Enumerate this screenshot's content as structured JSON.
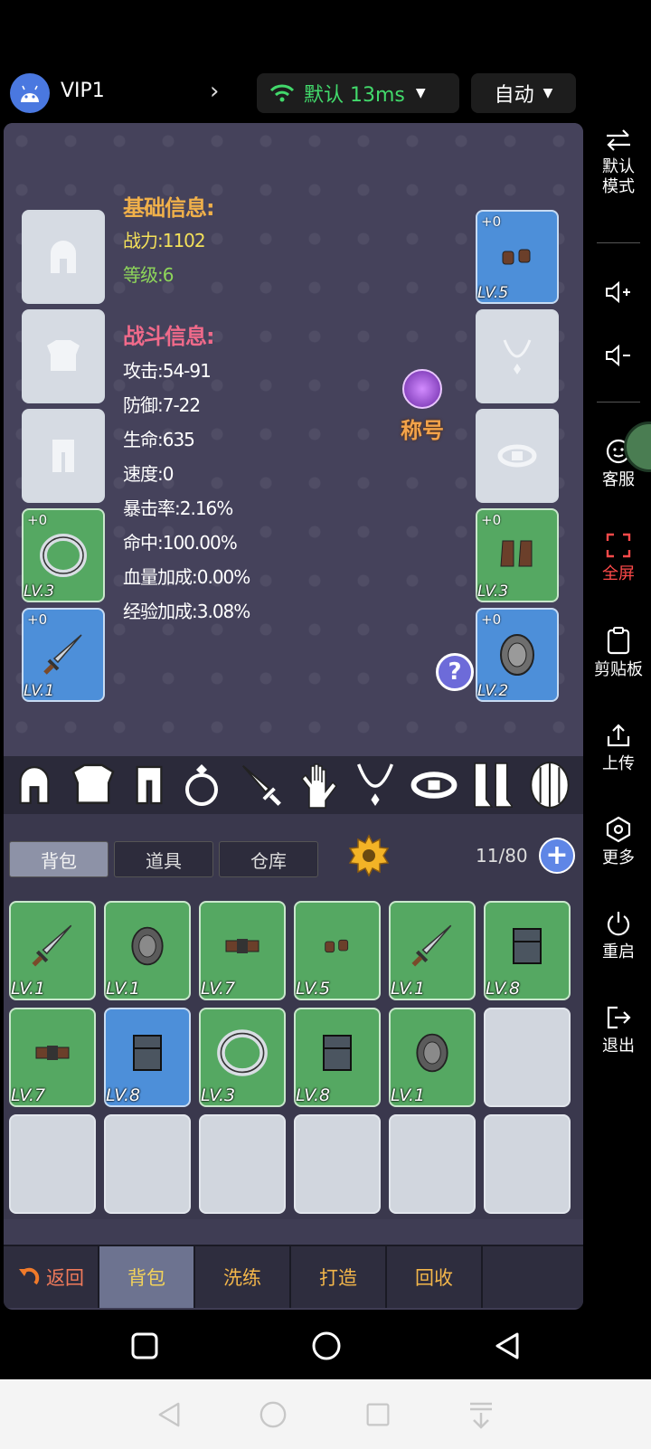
{
  "topbar": {
    "vip_label": "VIP1",
    "network_label": "默认 13ms",
    "mode_label": "自动"
  },
  "sidebar": {
    "items": [
      {
        "label": "默认\n模式",
        "label_line1": "默认",
        "label_line2": "模式",
        "icon": "swap-icon"
      },
      {
        "label": "",
        "icon": "volume-up-icon"
      },
      {
        "label": "",
        "icon": "volume-down-icon"
      },
      {
        "label": "客服",
        "icon": "chat-icon"
      },
      {
        "label": "全屏",
        "icon": "fullscreen-icon",
        "color": "#ff4a4a"
      },
      {
        "label": "剪贴板",
        "icon": "clipboard-icon"
      },
      {
        "label": "上传",
        "icon": "upload-icon"
      },
      {
        "label": "更多",
        "icon": "more-icon"
      },
      {
        "label": "重启",
        "icon": "power-icon"
      },
      {
        "label": "退出",
        "icon": "exit-icon"
      }
    ]
  },
  "character": {
    "base_title": "基础信息:",
    "power": "战力:1102",
    "level": "等级:6",
    "fight_title": "战斗信息:",
    "attack": "攻击:54-91",
    "defense": "防御:7-22",
    "hp": "生命:635",
    "speed": "速度:0",
    "crit": "暴击率:2.16%",
    "hit": "命中:100.00%",
    "hp_bonus": "血量加成:0.00%",
    "exp_bonus": "经验加成:3.08%",
    "title_badge": "称号",
    "help": "?"
  },
  "equip_left": [
    {
      "state": "empty",
      "icon": "helmet-icon"
    },
    {
      "state": "empty",
      "icon": "armor-icon"
    },
    {
      "state": "empty",
      "icon": "pants-icon"
    },
    {
      "state": "green",
      "icon": "ring-icon",
      "plus": "+0",
      "lv": "LV.3"
    },
    {
      "state": "blue",
      "icon": "sword-icon",
      "plus": "+0",
      "lv": "LV.1"
    }
  ],
  "equip_right": [
    {
      "state": "blue",
      "icon": "gloves-icon",
      "plus": "+0",
      "lv": "LV.5"
    },
    {
      "state": "empty",
      "icon": "necklace-icon"
    },
    {
      "state": "empty",
      "icon": "belt-icon"
    },
    {
      "state": "green",
      "icon": "boots-icon",
      "plus": "+0",
      "lv": "LV.3"
    },
    {
      "state": "blue",
      "icon": "shield-icon",
      "plus": "+0",
      "lv": "LV.2"
    }
  ],
  "categories": [
    "helmet-icon",
    "armor-icon",
    "pants-icon",
    "ring-icon",
    "sword-icon",
    "glove-icon",
    "necklace-icon",
    "belt-icon",
    "boots-icon",
    "shield-icon"
  ],
  "tabs": {
    "bag": "背包",
    "items": "道具",
    "warehouse": "仓库",
    "count": "11/80",
    "add": "+"
  },
  "inventory": [
    {
      "state": "green",
      "icon": "sword-icon",
      "lv": "LV.1"
    },
    {
      "state": "green",
      "icon": "shield-icon",
      "lv": "LV.1"
    },
    {
      "state": "green",
      "icon": "belt-icon",
      "lv": "LV.7"
    },
    {
      "state": "green",
      "icon": "gloves-icon",
      "lv": "LV.5"
    },
    {
      "state": "green",
      "icon": "sword-icon",
      "lv": "LV.1"
    },
    {
      "state": "green",
      "icon": "armor-icon",
      "lv": "LV.8"
    },
    {
      "state": "green",
      "icon": "belt-icon",
      "lv": "LV.7"
    },
    {
      "state": "blue",
      "icon": "armor-icon",
      "lv": "LV.8"
    },
    {
      "state": "green",
      "icon": "ring-icon",
      "lv": "LV.3"
    },
    {
      "state": "green",
      "icon": "armor-icon",
      "lv": "LV.8"
    },
    {
      "state": "green",
      "icon": "shield-icon",
      "lv": "LV.1"
    },
    {
      "state": "empty",
      "icon": "",
      "lv": ""
    },
    {
      "state": "empty",
      "icon": "",
      "lv": ""
    },
    {
      "state": "empty",
      "icon": "",
      "lv": ""
    },
    {
      "state": "empty",
      "icon": "",
      "lv": ""
    },
    {
      "state": "empty",
      "icon": "",
      "lv": ""
    },
    {
      "state": "empty",
      "icon": "",
      "lv": ""
    },
    {
      "state": "empty",
      "icon": "",
      "lv": ""
    }
  ],
  "bottom": {
    "back": "返回",
    "bag": "背包",
    "refine": "洗练",
    "forge": "打造",
    "recycle": "回收"
  }
}
